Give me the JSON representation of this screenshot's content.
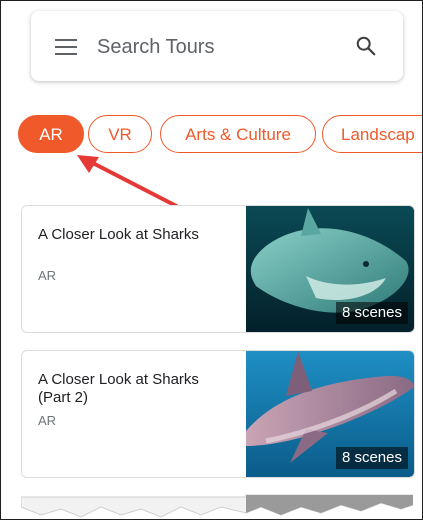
{
  "search": {
    "placeholder": "Search Tours",
    "icon_menu": "hamburger-menu-icon",
    "icon_search": "search-icon"
  },
  "chips": [
    {
      "label": "AR",
      "selected": true
    },
    {
      "label": "VR",
      "selected": false
    },
    {
      "label": "Arts & Culture",
      "selected": false
    },
    {
      "label": "Landscap",
      "selected": false
    }
  ],
  "accent_color": "#f05a2a",
  "annotation_arrow_color": "#e53935",
  "tours": [
    {
      "title": "A Closer Look at Sharks",
      "type": "AR",
      "scenes": "8 scenes"
    },
    {
      "title": "A Closer Look at Sharks (Part 2)",
      "type": "AR",
      "scenes": "8 scenes"
    }
  ]
}
